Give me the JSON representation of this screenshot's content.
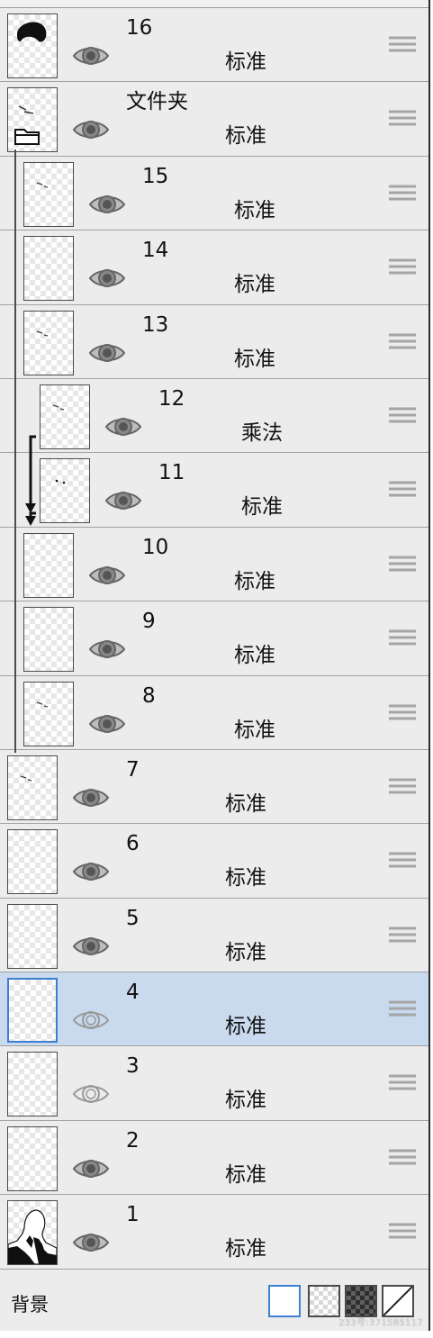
{
  "layers": [
    {
      "name": "16",
      "mode": "标准",
      "level": 0,
      "visible": true,
      "selected": false,
      "type": "layer",
      "thumb": "hair"
    },
    {
      "name": "文件夹",
      "mode": "标准",
      "level": 0,
      "visible": true,
      "selected": false,
      "type": "folder",
      "thumb": "folder"
    },
    {
      "name": "15",
      "mode": "标准",
      "level": 1,
      "visible": true,
      "selected": false,
      "type": "layer",
      "thumb": "specks"
    },
    {
      "name": "14",
      "mode": "标准",
      "level": 1,
      "visible": true,
      "selected": false,
      "type": "layer",
      "thumb": "blank"
    },
    {
      "name": "13",
      "mode": "标准",
      "level": 1,
      "visible": true,
      "selected": false,
      "type": "layer",
      "thumb": "specks"
    },
    {
      "name": "12",
      "mode": "乘法",
      "level": 2,
      "visible": true,
      "selected": false,
      "type": "clipping",
      "thumb": "specks"
    },
    {
      "name": "11",
      "mode": "标准",
      "level": 2,
      "visible": true,
      "selected": false,
      "type": "layer",
      "thumb": "dots"
    },
    {
      "name": "10",
      "mode": "标准",
      "level": 1,
      "visible": true,
      "selected": false,
      "type": "layer",
      "thumb": "blank"
    },
    {
      "name": "9",
      "mode": "标准",
      "level": 1,
      "visible": true,
      "selected": false,
      "type": "layer",
      "thumb": "blank"
    },
    {
      "name": "8",
      "mode": "标准",
      "level": 1,
      "visible": true,
      "selected": false,
      "type": "layer",
      "thumb": "specks"
    },
    {
      "name": "7",
      "mode": "标准",
      "level": 0,
      "visible": true,
      "selected": false,
      "type": "layer",
      "thumb": "specks"
    },
    {
      "name": "6",
      "mode": "标准",
      "level": 0,
      "visible": true,
      "selected": false,
      "type": "layer",
      "thumb": "blank"
    },
    {
      "name": "5",
      "mode": "标准",
      "level": 0,
      "visible": true,
      "selected": false,
      "type": "layer",
      "thumb": "blank"
    },
    {
      "name": "4",
      "mode": "标准",
      "level": 0,
      "visible": false,
      "selected": true,
      "type": "layer",
      "thumb": "blank"
    },
    {
      "name": "3",
      "mode": "标准",
      "level": 0,
      "visible": false,
      "selected": false,
      "type": "layer",
      "thumb": "blank"
    },
    {
      "name": "2",
      "mode": "标准",
      "level": 0,
      "visible": true,
      "selected": false,
      "type": "layer",
      "thumb": "blank"
    },
    {
      "name": "1",
      "mode": "标准",
      "level": 0,
      "visible": true,
      "selected": false,
      "type": "layer",
      "thumb": "figure"
    }
  ],
  "background": {
    "label": "背景",
    "options": [
      "white",
      "checker",
      "dark",
      "none"
    ],
    "selected": "white"
  },
  "watermark": "233号:371585117",
  "colors": {
    "selected_row": "#c9d9ee",
    "panel": "#ececec",
    "accent": "#3c7fd2"
  }
}
